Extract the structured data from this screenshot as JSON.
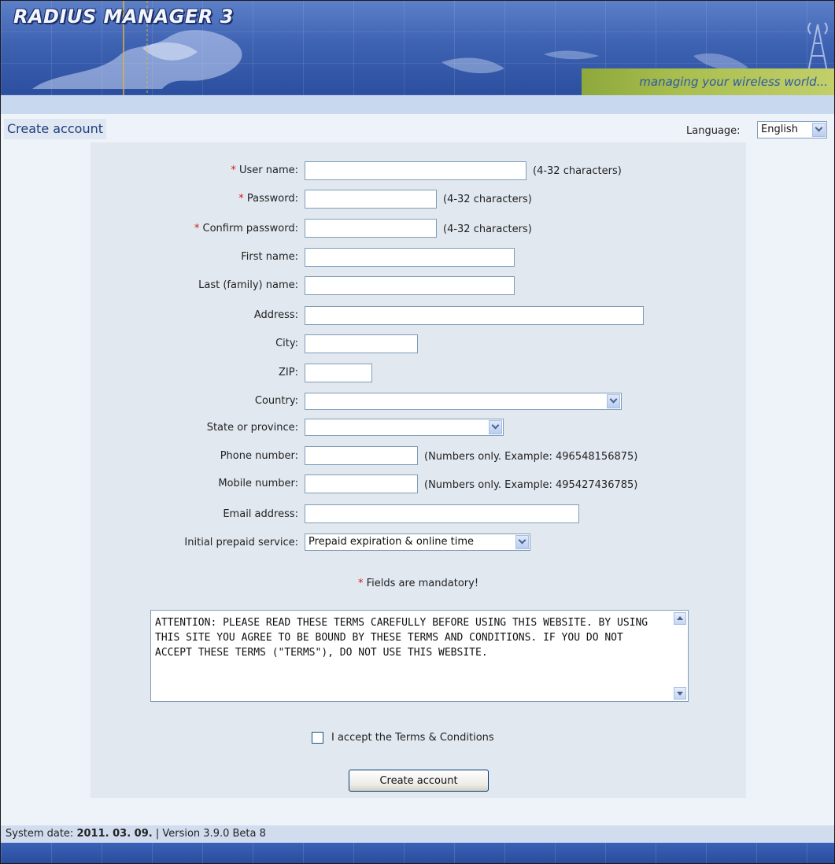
{
  "header": {
    "logo": "RADIUS MANAGER 3",
    "tagline": "managing your wireless world..."
  },
  "page": {
    "title": "Create account",
    "language_label": "Language:",
    "language_value": "English"
  },
  "form": {
    "required_marker": "*",
    "fields": {
      "username": {
        "label": "User name:",
        "hint": "(4-32 characters)",
        "value": ""
      },
      "password": {
        "label": "Password:",
        "hint": "(4-32 characters)",
        "value": ""
      },
      "confirm_password": {
        "label": "Confirm password:",
        "hint": "(4-32 characters)",
        "value": ""
      },
      "first_name": {
        "label": "First name:",
        "value": ""
      },
      "last_name": {
        "label": "Last (family) name:",
        "value": ""
      },
      "address": {
        "label": "Address:",
        "value": ""
      },
      "city": {
        "label": "City:",
        "value": ""
      },
      "zip": {
        "label": "ZIP:",
        "value": ""
      },
      "country": {
        "label": "Country:",
        "value": ""
      },
      "state": {
        "label": "State or province:",
        "value": ""
      },
      "phone": {
        "label": "Phone number:",
        "hint": "(Numbers only. Example: 496548156875)",
        "value": ""
      },
      "mobile": {
        "label": "Mobile number:",
        "hint": "(Numbers only. Example: 495427436785)",
        "value": ""
      },
      "email": {
        "label": "Email address:",
        "value": ""
      },
      "service": {
        "label": "Initial prepaid service:",
        "value": "Prepaid expiration & online time"
      }
    },
    "mandatory_note": "Fields are mandatory!",
    "terms_text": "ATTENTION: PLEASE READ THESE TERMS CAREFULLY BEFORE USING THIS WEBSITE. BY USING THIS SITE YOU AGREE TO BE BOUND BY THESE TERMS AND CONDITIONS. IF YOU DO NOT ACCEPT THESE TERMS (\"TERMS\"), DO NOT USE THIS WEBSITE.",
    "accept_label": "I accept the Terms & Conditions",
    "accept_checked": false,
    "submit_label": "Create account"
  },
  "footer": {
    "system_date_label": "System date:",
    "system_date": "2011. 03. 09.",
    "separator": "|",
    "version": "Version 3.9.0 Beta 8"
  },
  "colors": {
    "banner": "#3f63b3",
    "tagline_box": "#aabf4e",
    "panel": "#e2e8f0",
    "required_star": "#d21a1a"
  }
}
